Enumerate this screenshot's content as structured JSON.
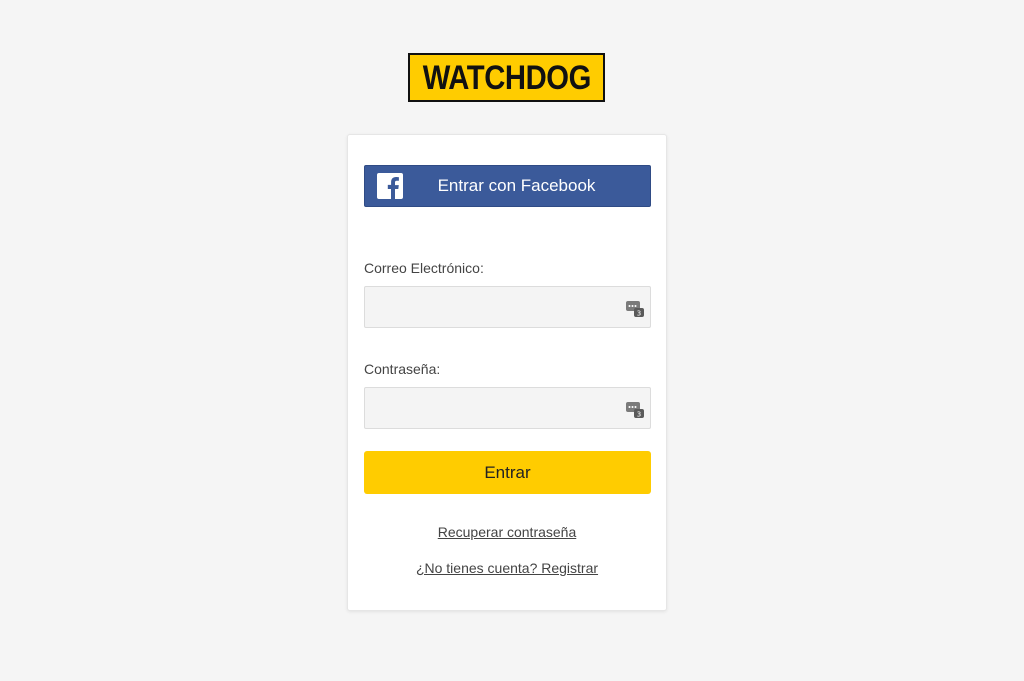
{
  "brand": {
    "logo_text": "WATCHDOG",
    "logo_bg": "#ffcc00",
    "logo_border": "#111111"
  },
  "login": {
    "facebook_label": "Entrar con Facebook",
    "facebook_color": "#3b5a9a",
    "email_label": "Correo Electrónico:",
    "email_value": "",
    "password_label": "Contraseña:",
    "password_value": "",
    "submit_label": "Entrar",
    "submit_color": "#ffcc00",
    "recover_link": "Recuperar contraseña",
    "register_link": "¿No tienes cuenta? Registrar"
  },
  "icons": {
    "facebook": "facebook-icon",
    "password_manager": "password-manager-icon"
  }
}
